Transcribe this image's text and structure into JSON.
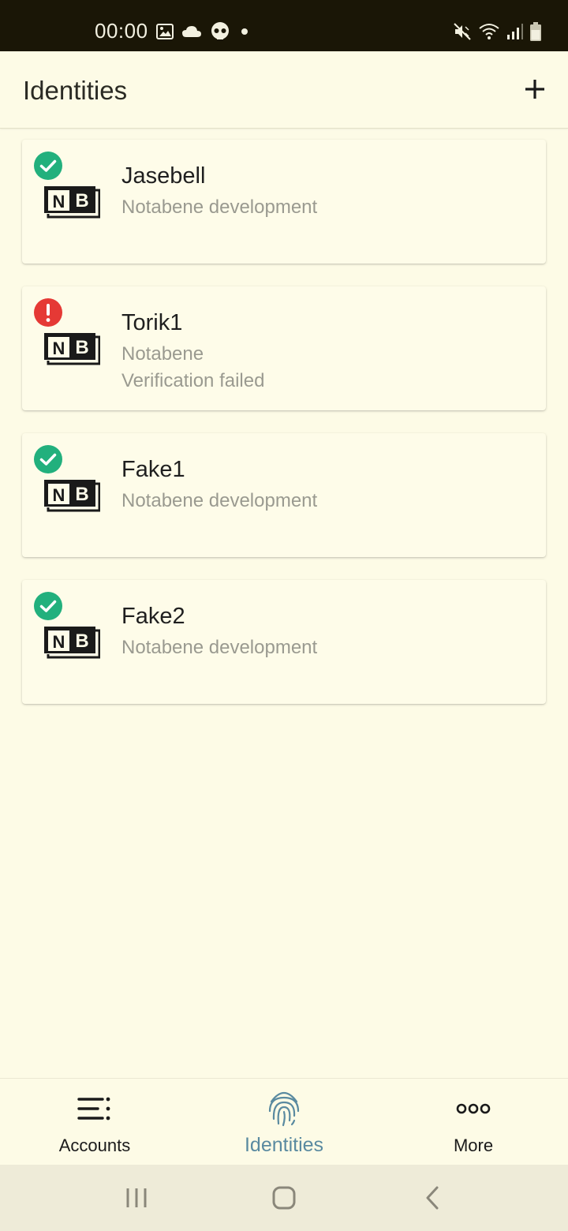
{
  "status_bar": {
    "time": "00:00",
    "left_icons": [
      "image-icon",
      "cloud-icon",
      "skull-icon",
      "dot-icon"
    ],
    "right_icons": [
      "mute-icon",
      "wifi-icon",
      "signal-icon",
      "battery-icon"
    ]
  },
  "header": {
    "title": "Identities",
    "add_icon": "plus-icon"
  },
  "identities": [
    {
      "name": "Jasebell",
      "subtitle": "Notabene development",
      "status": "verified",
      "status_icon": "check-circle-icon",
      "status_color": "#22b07d",
      "logo": "NB"
    },
    {
      "name": "Torik1",
      "subtitle": "Notabene",
      "detail": "Verification failed",
      "status": "failed",
      "status_icon": "error-circle-icon",
      "status_color": "#e53935",
      "logo": "NB"
    },
    {
      "name": "Fake1",
      "subtitle": "Notabene development",
      "status": "verified",
      "status_icon": "check-circle-icon",
      "status_color": "#22b07d",
      "logo": "NB"
    },
    {
      "name": "Fake2",
      "subtitle": "Notabene development",
      "status": "verified",
      "status_icon": "check-circle-icon",
      "status_color": "#22b07d",
      "logo": "NB"
    }
  ],
  "bottom_nav": {
    "items": [
      {
        "label": "Accounts",
        "icon": "list-icon",
        "active": false
      },
      {
        "label": "Identities",
        "icon": "fingerprint-icon",
        "active": true
      },
      {
        "label": "More",
        "icon": "more-horizontal-icon",
        "active": false
      }
    ],
    "active_color": "#5a8aa0"
  },
  "system_nav": [
    "recents-icon",
    "home-icon",
    "back-icon"
  ]
}
